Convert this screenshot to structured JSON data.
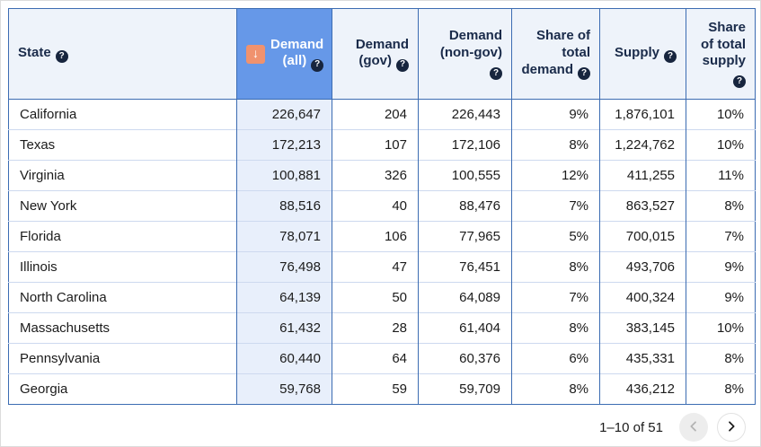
{
  "table": {
    "columns": [
      {
        "key": "state",
        "label": "State",
        "align": "left"
      },
      {
        "key": "demand_all",
        "label": "Demand (all)",
        "align": "right",
        "sorted": true
      },
      {
        "key": "demand_gov",
        "label": "Demand (gov)",
        "align": "right"
      },
      {
        "key": "demand_nongov",
        "label": "Demand (non-gov)",
        "align": "right"
      },
      {
        "key": "share_demand",
        "label": "Share of total demand",
        "align": "right"
      },
      {
        "key": "supply",
        "label": "Supply",
        "align": "right"
      },
      {
        "key": "share_supply",
        "label": "Share of total supply",
        "align": "right"
      }
    ],
    "rows": [
      [
        "California",
        "226,647",
        "204",
        "226,443",
        "9%",
        "1,876,101",
        "10%"
      ],
      [
        "Texas",
        "172,213",
        "107",
        "172,106",
        "8%",
        "1,224,762",
        "10%"
      ],
      [
        "Virginia",
        "100,881",
        "326",
        "100,555",
        "12%",
        "411,255",
        "11%"
      ],
      [
        "New York",
        "88,516",
        "40",
        "88,476",
        "7%",
        "863,527",
        "8%"
      ],
      [
        "Florida",
        "78,071",
        "106",
        "77,965",
        "5%",
        "700,015",
        "7%"
      ],
      [
        "Illinois",
        "76,498",
        "47",
        "76,451",
        "8%",
        "493,706",
        "9%"
      ],
      [
        "North Carolina",
        "64,139",
        "50",
        "64,089",
        "7%",
        "400,324",
        "9%"
      ],
      [
        "Massachusetts",
        "61,432",
        "28",
        "61,404",
        "8%",
        "383,145",
        "10%"
      ],
      [
        "Pennsylvania",
        "60,440",
        "64",
        "60,376",
        "6%",
        "435,331",
        "8%"
      ],
      [
        "Georgia",
        "59,768",
        "59",
        "59,709",
        "8%",
        "436,212",
        "8%"
      ]
    ]
  },
  "icons": {
    "sort_desc": "↓",
    "help": "?"
  },
  "pagination": {
    "range_label": "1–10 of 51"
  },
  "colors": {
    "sorted_header_bg": "#6698e8",
    "sorted_cell_bg": "#e8effb",
    "header_bg": "#eef3fa",
    "border_blue": "#3c6cb2",
    "row_divider": "#cdd9ef",
    "sort_icon_bg": "#f0926e",
    "help_icon_bg": "#17253e"
  }
}
